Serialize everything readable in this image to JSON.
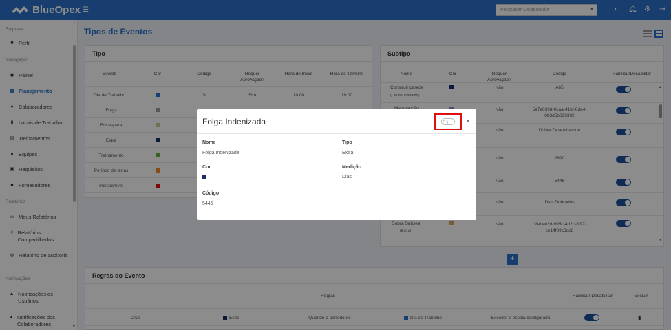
{
  "brand": {
    "name": "BlueOpex",
    "accent": "#2a72c8"
  },
  "topbar": {
    "menu_icon": "hamburger-icon",
    "search_placeholder": "Pesquisar Colaborador",
    "icons": [
      "palette-icon",
      "bell-icon",
      "gear-icon",
      "logout-icon"
    ]
  },
  "sidebar": {
    "sections": [
      {
        "label": "Empresa"
      },
      {
        "label": "Navegação"
      },
      {
        "label": "Relatórios"
      },
      {
        "label": "Notificações"
      }
    ],
    "items": [
      {
        "label": "Perfil",
        "icon": "briefcase-icon"
      },
      {
        "label": "Painel",
        "icon": "dashboard-icon"
      },
      {
        "label": "Planejamento",
        "icon": "calendar-icon",
        "active": true
      },
      {
        "label": "Colaboradores",
        "icon": "users-icon"
      },
      {
        "label": "Locais de Trabalho",
        "icon": "building-icon"
      },
      {
        "label": "Treinamentos",
        "icon": "training-icon"
      },
      {
        "label": "Equipes",
        "icon": "team-icon"
      },
      {
        "label": "Requisitos",
        "icon": "checklist-icon"
      },
      {
        "label": "Fornecedores",
        "icon": "supplier-icon"
      },
      {
        "label": "Meus Relatórios",
        "icon": "print-icon"
      },
      {
        "label": "Relatórios Compartilhados",
        "icon": "share-icon"
      },
      {
        "label": "Relatório de auditoria",
        "icon": "search-doc-icon"
      },
      {
        "label": "Notificações de Usuários",
        "icon": "bell-icon"
      },
      {
        "label": "Notificações dos Colaboradores",
        "icon": "bell-icon"
      }
    ]
  },
  "page": {
    "title": "Tipos de Eventos"
  },
  "tipo": {
    "title": "Tipo",
    "headers": [
      "Evento",
      "Cor",
      "Código",
      "Requer Aprovação?",
      "Hora de Início",
      "Hora de Término"
    ],
    "rows": [
      {
        "evento": "Dia de Trabalho",
        "cor": "#2a72c8",
        "codigo": "S",
        "aprov": "Sim",
        "inicio": "10:00",
        "fim": "19:00"
      },
      {
        "evento": "Folga",
        "cor": "#9e9e9e",
        "codigo": "",
        "aprov": "",
        "inicio": "",
        "fim": ""
      },
      {
        "evento": "Em espera",
        "cor": "#c8cf9a",
        "codigo": "",
        "aprov": "",
        "inicio": "",
        "fim": ""
      },
      {
        "evento": "Extra",
        "cor": "#1b2f6b",
        "codigo": "",
        "aprov": "",
        "inicio": "",
        "fim": ""
      },
      {
        "evento": "Treinamento",
        "cor": "#6fb23a",
        "codigo": "",
        "aprov": "",
        "inicio": "",
        "fim": ""
      },
      {
        "evento": "Período de férias",
        "cor": "#f08a2a",
        "codigo": "",
        "aprov": "",
        "inicio": "",
        "fim": ""
      },
      {
        "evento": "Indisponível",
        "cor": "#e01010",
        "codigo": "",
        "aprov": "",
        "inicio": "",
        "fim": ""
      }
    ]
  },
  "subtipo": {
    "title": "Subtipo",
    "headers": [
      "Nome",
      "Cor",
      "Requer Aprovação?",
      "Código",
      "Habilitar/Desabilitar"
    ],
    "rows": [
      {
        "nome": "Construir parede",
        "sub": "(Dia de Trabalho)",
        "cor": "#1b2f6b",
        "aprov": "Não",
        "codigo": "A65"
      },
      {
        "nome": "Manutenção",
        "sub": "",
        "cor": "#9b7ad0",
        "aprov": "Não",
        "codigo": "5a7a039d-0caa-41fd-0da4-063d5b029392"
      },
      {
        "nome": "",
        "sub": "",
        "cor": "",
        "aprov": "Não",
        "codigo": "Dobra Desembarque"
      },
      {
        "nome": "",
        "sub": "",
        "cor": "",
        "aprov": "Não",
        "codigo": "2890"
      },
      {
        "nome": "",
        "sub": "",
        "cor": "",
        "aprov": "Não",
        "codigo": "5446"
      },
      {
        "nome": "",
        "sub": "",
        "cor": "",
        "aprov": "Não",
        "codigo": "Dias Dobrados"
      },
      {
        "nome": "Dobra Subsea",
        "sub": "(Extra)",
        "cor": "#d9a86a",
        "aprov": "Não",
        "codigo": "c2ebee26-995c-4d2c-8f97-ce14f09c3dd8"
      }
    ]
  },
  "regras": {
    "title": "Regras do Evento",
    "headers": [
      "Regras",
      "Habilitar/ Desabilitar",
      "Excluir"
    ],
    "row": {
      "acao": "Criar",
      "evento": "Extra",
      "condicao": "Quando o período de",
      "alvo": "Dia de Trabalho",
      "resultado": "Exceder a escala configurada"
    }
  },
  "modal": {
    "title": "Folga Indenizada",
    "fields": {
      "nome_label": "Nome",
      "nome_value": "Folga Indenizada",
      "tipo_label": "Tipo",
      "tipo_value": "Extra",
      "cor_label": "Cor",
      "cor_value": "#1b2f6b",
      "medicao_label": "Medição",
      "medicao_value": "Dias",
      "codigo_label": "Código",
      "codigo_value": "5446"
    },
    "toggle_enabled": false,
    "close_label": "×"
  },
  "add_button": "+"
}
